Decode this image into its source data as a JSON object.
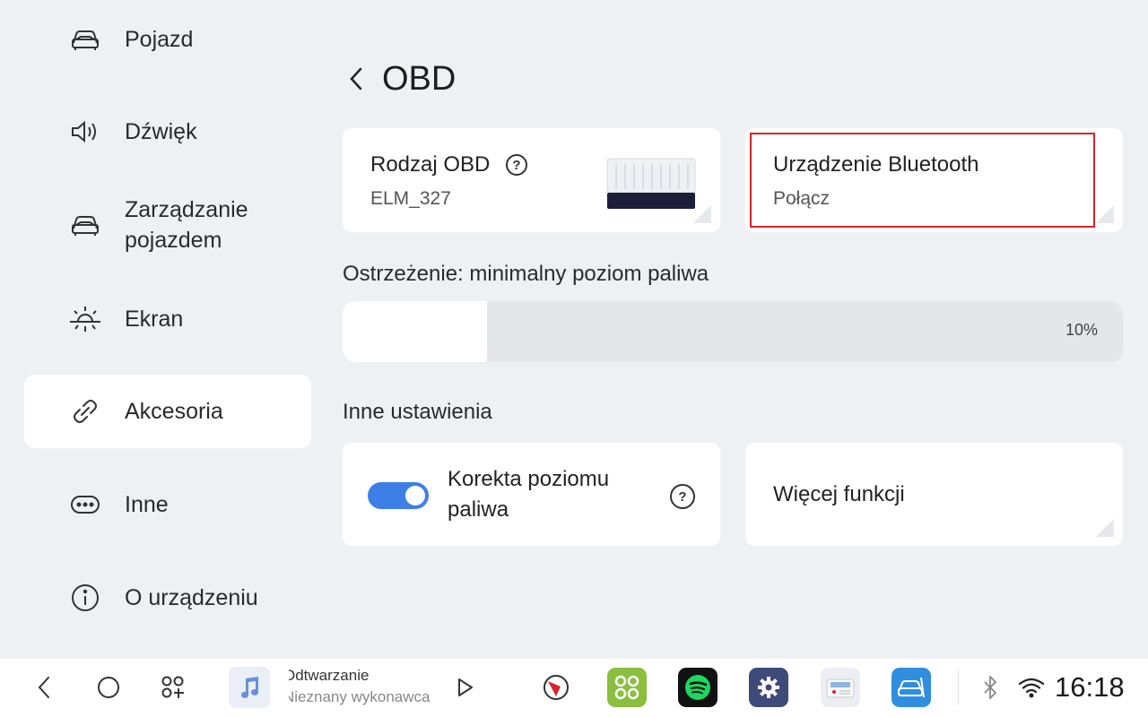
{
  "sidebar": {
    "items": [
      {
        "label": "Pojazd",
        "icon": "car-icon",
        "active": false
      },
      {
        "label": "Dźwięk",
        "icon": "speaker-icon",
        "active": false
      },
      {
        "label": "Zarządzanie\npojazdem",
        "icon": "car-manage-icon",
        "active": false
      },
      {
        "label": "Ekran",
        "icon": "brightness-icon",
        "active": false
      },
      {
        "label": "Akcesoria",
        "icon": "link-icon",
        "active": true
      },
      {
        "label": "Inne",
        "icon": "more-icon",
        "active": false
      },
      {
        "label": "O urządzeniu",
        "icon": "info-icon",
        "active": false
      }
    ]
  },
  "header": {
    "title": "OBD"
  },
  "obd_card": {
    "title": "Rodzaj OBD",
    "value": "ELM_327"
  },
  "bluetooth_card": {
    "title": "Urządzenie Bluetooth",
    "value": "Połącz"
  },
  "fuel_warning": {
    "label": "Ostrzeżenie: minimalny poziom paliwa",
    "value_text": "10%",
    "level": 0.1
  },
  "other_settings": {
    "label": "Inne ustawienia",
    "fuel_correction": {
      "label": "Korekta poziomu paliwa",
      "enabled": true
    },
    "more_functions": {
      "label": "Więcej funkcji"
    }
  },
  "taskbar": {
    "media_title": "Odtwarzanie",
    "media_artist": "Nieznany wykonawca",
    "clock": "16:18"
  },
  "colors": {
    "accent": "#3d7fe6",
    "highlight": "#d9232d",
    "background": "#eef1f4"
  }
}
